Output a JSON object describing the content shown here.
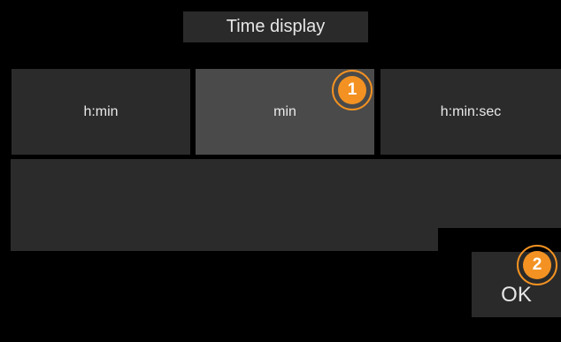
{
  "title": "Time display",
  "options": [
    {
      "label": "h:min",
      "selected": false
    },
    {
      "label": "min",
      "selected": true
    },
    {
      "label": "h:min:sec",
      "selected": false
    }
  ],
  "ok_label": "OK",
  "markers": [
    "1",
    "2"
  ],
  "colors": {
    "background": "#000000",
    "panel": "#2b2b2b",
    "selected": "#4a4a4a",
    "text": "#e6e6e6",
    "marker": "#f39222"
  }
}
